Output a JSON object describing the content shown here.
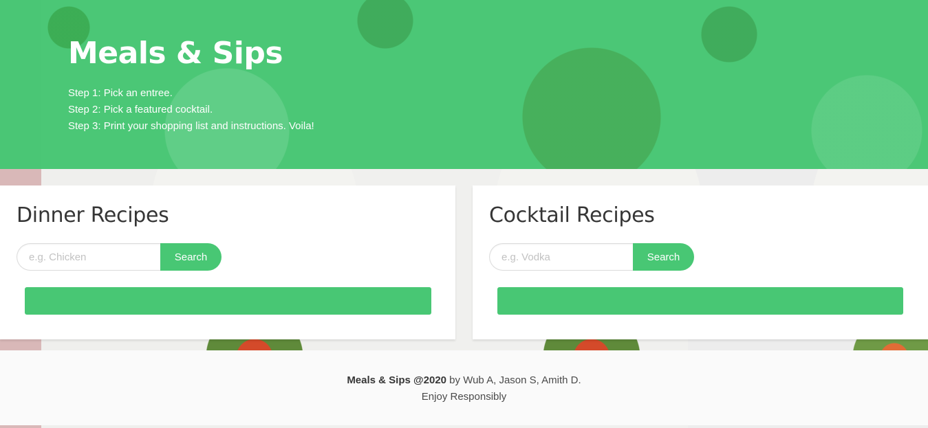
{
  "hero": {
    "title": "Meals & Sips",
    "steps": [
      "Step 1: Pick an entree.",
      "Step 2: Pick a featured cocktail.",
      "Step 3: Print your shopping list and instructions. Voila!"
    ]
  },
  "dinner": {
    "title": "Dinner Recipes",
    "placeholder": "e.g. Chicken",
    "value": "",
    "search_label": "Search"
  },
  "cocktail": {
    "title": "Cocktail Recipes",
    "placeholder": "e.g. Vodka",
    "value": "",
    "search_label": "Search"
  },
  "footer": {
    "brand": "Meals & Sips @2020",
    "authors": " by Wub A, Jason S, Amith D.",
    "tagline": "Enjoy Responsibly"
  },
  "colors": {
    "primary": "#48c774",
    "text_dark": "#363636",
    "footer_bg": "#fafafa"
  }
}
